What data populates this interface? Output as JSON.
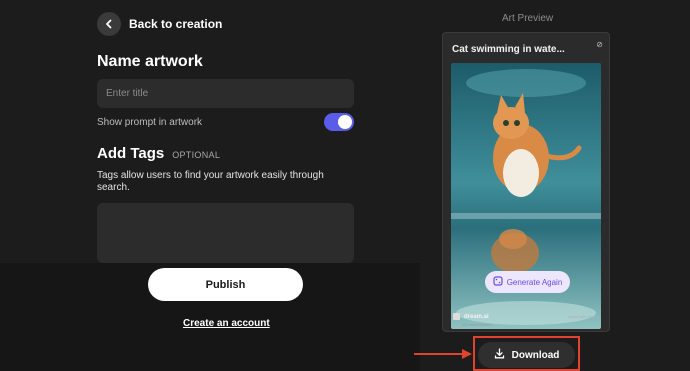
{
  "nav": {
    "back_label": "Back to creation"
  },
  "form": {
    "name_title": "Name artwork",
    "title_placeholder": "Enter title",
    "show_prompt_label": "Show prompt in artwork",
    "show_prompt_enabled": true,
    "tags_title": "Add Tags",
    "tags_optional": "OPTIONAL",
    "tags_help": "Tags allow users to find your artwork easily through search.",
    "publish_label": "Publish",
    "create_account_label": "Create an account"
  },
  "preview": {
    "heading": "Art Preview",
    "card_title": "Cat swimming in wate...",
    "generate_again_label": "Generate Again",
    "brand_name": "dream.ai",
    "brand_sub": "#DreamDiffusion",
    "made_with": "made with dream",
    "download_label": "Download"
  },
  "colors": {
    "accent": "#5b5ce8",
    "highlight": "#e2432e",
    "background": "#1c1c1c"
  },
  "icons": {
    "back": "chevron-left-icon",
    "download": "download-icon",
    "generate": "dice-icon",
    "pointer": "arrow-right-icon"
  }
}
